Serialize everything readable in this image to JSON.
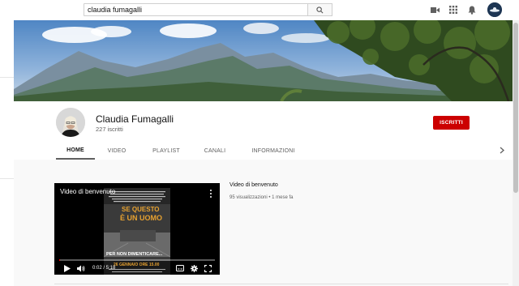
{
  "search": {
    "query": "claudia fumagalli"
  },
  "topbar": {
    "icons": [
      "search-icon",
      "video-camera-icon",
      "apps-grid-icon",
      "bell-icon",
      "account-avatar"
    ]
  },
  "channel": {
    "name": "Claudia Fumagalli",
    "subscribers": "227 iscritti",
    "subscribe_label": "ISCRITTI"
  },
  "tabs": [
    {
      "label": "HOME",
      "active": true
    },
    {
      "label": "VIDEO",
      "active": false
    },
    {
      "label": "PLAYLIST",
      "active": false
    },
    {
      "label": "CANALI",
      "active": false
    },
    {
      "label": "INFORMAZIONI",
      "active": false
    }
  ],
  "featured_video": {
    "player_title": "Video di benvenuto",
    "time": "0:02 / 5:18",
    "progress": 0.006,
    "poster_line1": "SE QUESTO",
    "poster_line2": "È UN UOMO",
    "poster_line3": "PER NON DIMENTICARE...",
    "poster_line4": "26 GENNAIO ORE 15.00",
    "info_title": "Video di benvenuto",
    "info_meta": "95 visualizzazioni • 1 mese fa"
  },
  "colors": {
    "subscribe": "#cc0000",
    "progress": "#ff0000"
  }
}
